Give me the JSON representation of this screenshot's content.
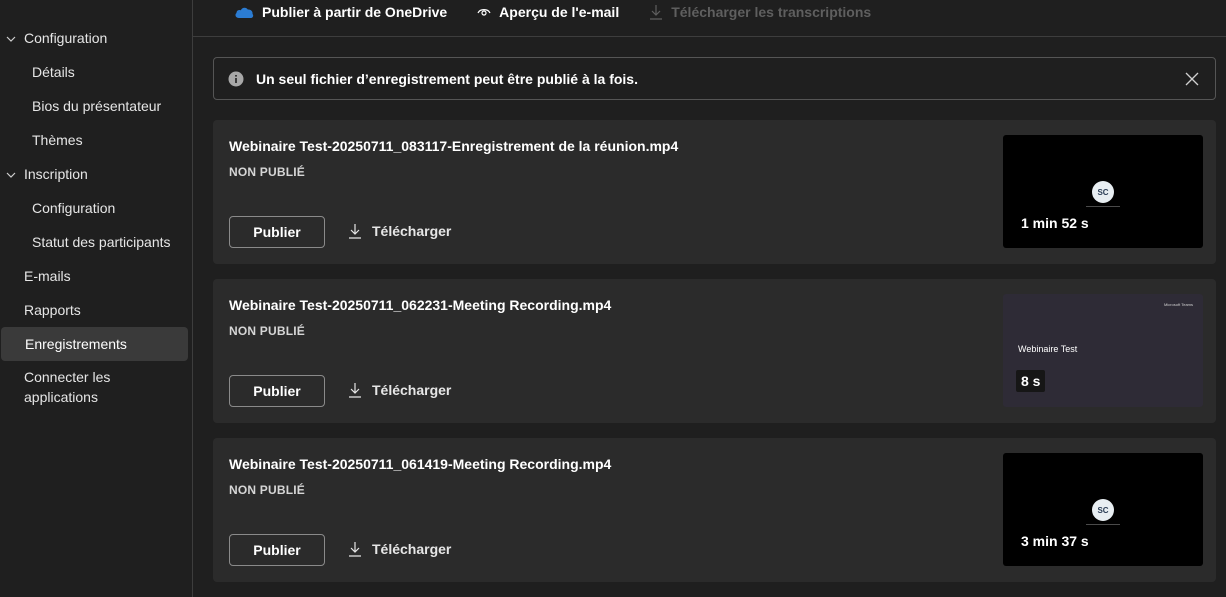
{
  "sidebar": {
    "groups": [
      {
        "label": "Configuration",
        "children": [
          "Détails",
          "Bios du présentateur",
          "Thèmes"
        ]
      },
      {
        "label": "Inscription",
        "children": [
          "Configuration",
          "Statut des participants"
        ]
      }
    ],
    "items": [
      "E-mails",
      "Rapports",
      "Enregistrements",
      "Connecter les applications"
    ],
    "active_item": "Enregistrements"
  },
  "toolbar": {
    "publish_onedrive": "Publier à partir de OneDrive",
    "email_preview": "Aperçu de l'e-mail",
    "download_transcripts": "Télécharger les transcriptions"
  },
  "banner": {
    "message": "Un seul fichier d’enregistrement peut être publié à la fois."
  },
  "recordings": [
    {
      "title": "Webinaire Test-20250711_083117-Enregistrement de la réunion.mp4",
      "status": "NON PUBLIÉ",
      "publish_label": "Publier",
      "download_label": "Télécharger",
      "duration": "1 min 52 s",
      "avatar": "SC"
    },
    {
      "title": "Webinaire Test-20250711_062231-Meeting Recording.mp4",
      "status": "NON PUBLIÉ",
      "publish_label": "Publier",
      "download_label": "Télécharger",
      "duration": "8 s",
      "slide_title": "Webinaire Test",
      "slide_brand": "Microsoft Teams"
    },
    {
      "title": "Webinaire Test-20250711_061419-Meeting Recording.mp4",
      "status": "NON PUBLIÉ",
      "publish_label": "Publier",
      "download_label": "Télécharger",
      "duration": "3 min 37 s",
      "avatar": "SC"
    }
  ],
  "colors": {
    "background": "#1f1f1f",
    "card": "#2b2b2b",
    "active_nav": "#3a3a3a",
    "onedrive": "#2b7cd3"
  }
}
